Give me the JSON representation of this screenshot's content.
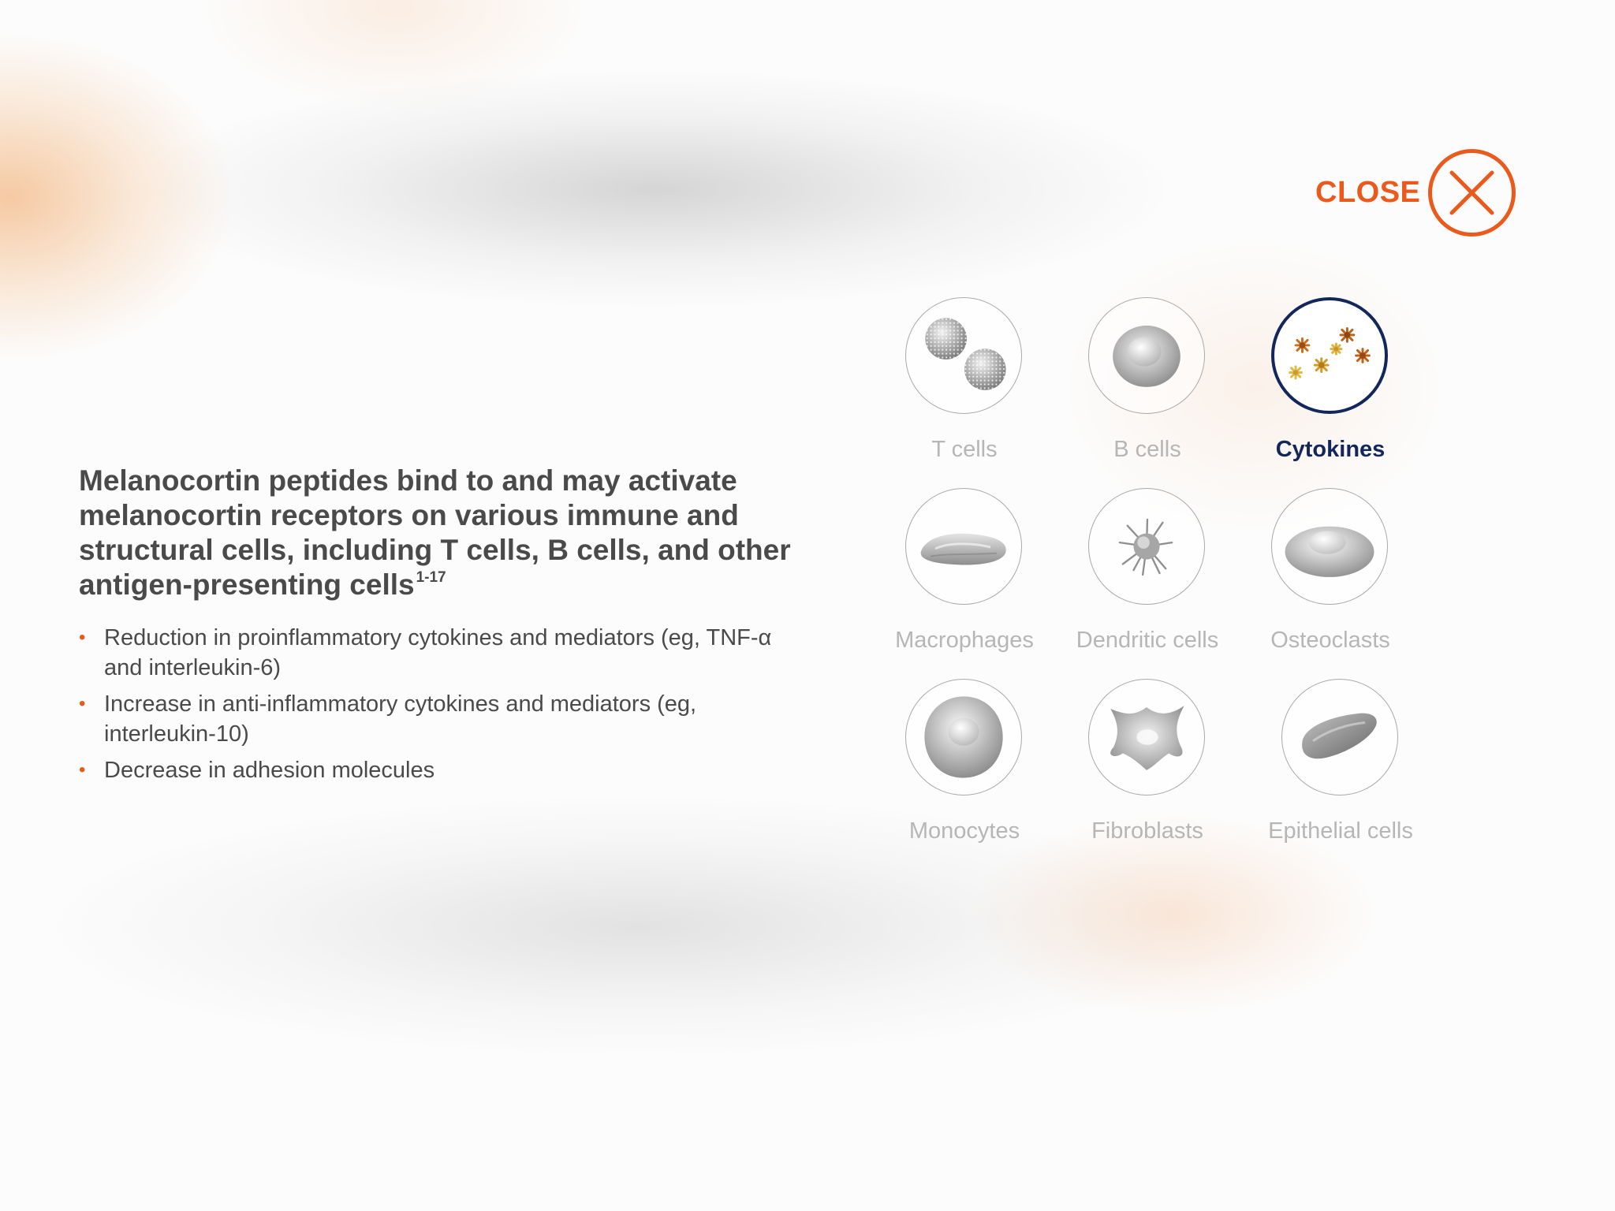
{
  "close": {
    "label": "CLOSE",
    "color": "#ea5a1c"
  },
  "headline": {
    "text": "Melanocortin peptides bind to and may activate melanocortin receptors on various immune and structural cells, including T cells, B cells, and other antigen-presenting cells",
    "superscript": "1-17"
  },
  "bullets": [
    {
      "marker": "•",
      "text": "Reduction in proinflammatory cytokines and mediators (eg, TNF-α and interleukin-6)"
    },
    {
      "marker": "•",
      "text": "Increase in anti-inflammatory cytokines and mediators (eg, interleukin-10)"
    },
    {
      "marker": "•",
      "text": "Decrease in adhesion molecules"
    }
  ],
  "cells": [
    {
      "label": "T cells",
      "icon": "t-cells-icon",
      "selected": false
    },
    {
      "label": "B cells",
      "icon": "b-cells-icon",
      "selected": false
    },
    {
      "label": "Cytokines",
      "icon": "cytokines-icon",
      "selected": true
    },
    {
      "label": "Macrophages",
      "icon": "macrophages-icon",
      "selected": false
    },
    {
      "label": "Dendritic cells",
      "icon": "dendritic-cells-icon",
      "selected": false
    },
    {
      "label": "Osteoclasts",
      "icon": "osteoclasts-icon",
      "selected": false
    },
    {
      "label": "Monocytes",
      "icon": "monocytes-icon",
      "selected": false
    },
    {
      "label": "Fibroblasts",
      "icon": "fibroblasts-icon",
      "selected": false
    },
    {
      "label": "Epithelial cells",
      "icon": "epithelial-cells-icon",
      "selected": false
    }
  ],
  "colors": {
    "accent": "#ea5a1c",
    "selected": "#13275a",
    "text": "#4a4a4a",
    "muted_label": "#b6b6b6"
  }
}
